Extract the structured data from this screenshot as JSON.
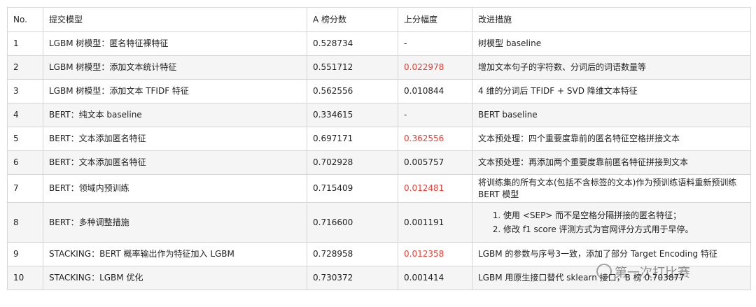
{
  "table": {
    "headers": [
      "No.",
      "提交模型",
      "A 榜分数",
      "上分幅度",
      "改进措施"
    ],
    "rows": [
      {
        "no": "1",
        "model": "LGBM 树模型：匿名特征裸特征",
        "score": "0.528734",
        "delta": "-",
        "delta_highlight": false,
        "improvement": "树模型 baseline"
      },
      {
        "no": "2",
        "model": "LGBM 树模型：添加文本统计特征",
        "score": "0.551712",
        "delta": "0.022978",
        "delta_highlight": true,
        "improvement": "增加文本句子的字符数、分词后的词语数量等"
      },
      {
        "no": "3",
        "model": "LGBM 树模型：添加文本 TFIDF 特征",
        "score": "0.562556",
        "delta": "0.010844",
        "delta_highlight": false,
        "improvement": "4 维的分词后 TFIDF + SVD 降维文本特征"
      },
      {
        "no": "4",
        "model": "BERT：纯文本 baseline",
        "score": "0.334615",
        "delta": "-",
        "delta_highlight": false,
        "improvement": "BERT baseline"
      },
      {
        "no": "5",
        "model": "BERT：文本添加匿名特征",
        "score": "0.697171",
        "delta": "0.362556",
        "delta_highlight": true,
        "improvement": "文本预处理：四个重要度靠前的匿名特征空格拼接文本"
      },
      {
        "no": "6",
        "model": "BERT：文本添加匿名特征",
        "score": "0.702928",
        "delta": "0.005757",
        "delta_highlight": false,
        "improvement": "文本预处理：再添加两个重要度靠前匿名特征拼接到文本"
      },
      {
        "no": "7",
        "model": "BERT：领域内预训练",
        "score": "0.715409",
        "delta": "0.012481",
        "delta_highlight": true,
        "improvement": "将训练集的所有文本(包括不含标签的文本)作为预训练语料重新预训练 BERT 模型"
      },
      {
        "no": "8",
        "model": "BERT：多种调整措施",
        "score": "0.716600",
        "delta": "0.001191",
        "delta_highlight": false,
        "improvement_list": [
          "使用 <SEP> 而不是空格分隔拼接的匿名特征；",
          "修改 f1 score 评测方式为官网评分方式用于早停。"
        ]
      },
      {
        "no": "9",
        "model": "STACKING：BERT 概率输出作为特征加入 LGBM",
        "score": "0.728958",
        "delta": "0.012358",
        "delta_highlight": true,
        "improvement": "LGBM 的参数与序号3一致，添加了部分 Target Encoding 特征"
      },
      {
        "no": "10",
        "model": "STACKING：LGBM 优化",
        "score": "0.730372",
        "delta": "0.001414",
        "delta_highlight": false,
        "improvement": "LGBM 用原生接口替代 sklearn 接口，B 榜 0.703877"
      }
    ]
  },
  "watermark": {
    "text": "第一次打比赛"
  },
  "colors": {
    "highlight": "#e0443a",
    "border": "#d6d6d6",
    "stripe": "#f5f5f5"
  }
}
